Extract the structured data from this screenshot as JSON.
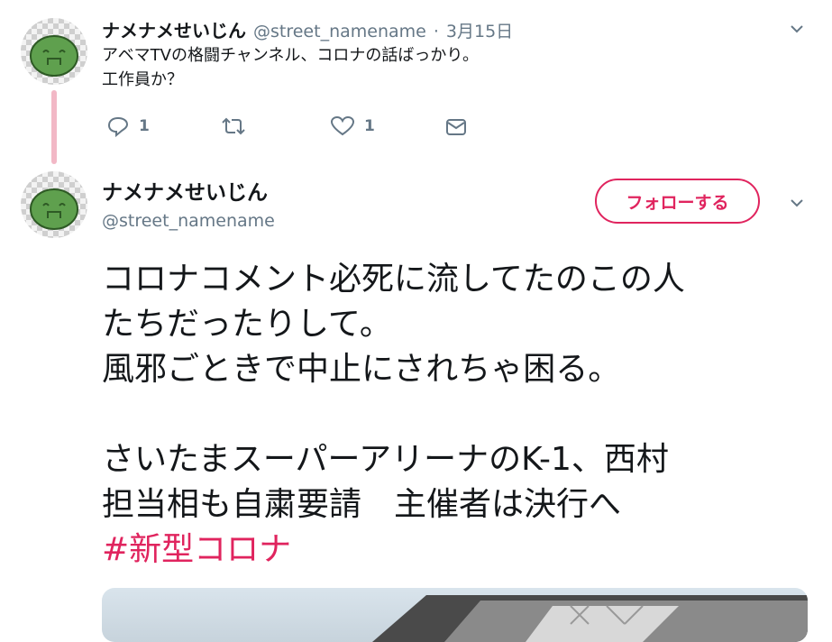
{
  "tweet1": {
    "name": "ナメナメせいじん",
    "handle": "@street_namename",
    "dot": "·",
    "date": "3月15日",
    "text_lines": [
      "アベマTVの格闘チャンネル、コロナの話ばっかり。",
      "工作員か？"
    ],
    "actions": {
      "reply_count": "1",
      "retweet_count": "",
      "like_count": "1"
    },
    "icons": [
      "reply-icon",
      "retweet-icon",
      "like-icon",
      "dm-icon",
      "chevron-down-icon"
    ]
  },
  "tweet2": {
    "name": "ナメナメせいじん",
    "handle": "@street_namename",
    "follow_label": "フォローする",
    "text_lines": [
      "コロナコメント必死に流してたのこの人",
      "たちだったりして。",
      "風邪ごときで中止にされちゃ困る。",
      "",
      "さいたまスーパーアリーナのK-1、西村",
      "担当相も自粛要請　主催者は決行へ"
    ],
    "hashtag": "#新型コロナ"
  },
  "colors": {
    "accent": "#e0245e",
    "secondary_text": "#657786",
    "thread_line": "#f2b8c6"
  }
}
